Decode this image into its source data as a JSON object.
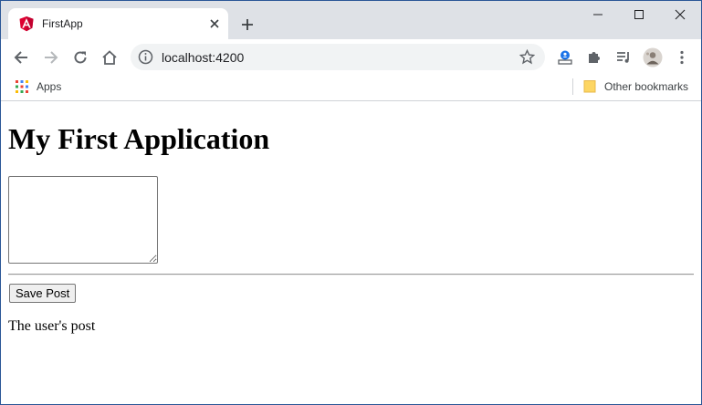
{
  "browser": {
    "tab": {
      "title": "FirstApp"
    },
    "address_bar": {
      "url": "localhost:4200"
    },
    "bookmarks": {
      "apps_label": "Apps",
      "other_label": "Other bookmarks"
    }
  },
  "page": {
    "heading": "My First Application",
    "textarea_value": "",
    "save_button_label": "Save Post",
    "post_output": "The user's post"
  },
  "colors": {
    "tabstrip": "#dee1e6",
    "window_border": "#2b5797",
    "angular_red": "#dd0031"
  }
}
